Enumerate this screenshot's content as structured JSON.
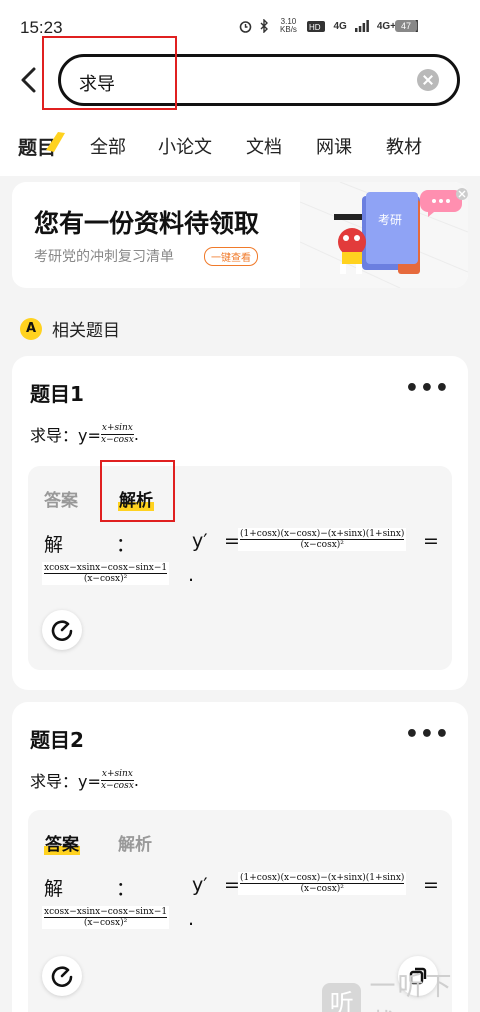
{
  "status_bar": {
    "time": "15:23",
    "speed": "3.10 KB/s",
    "network1": "4G",
    "network2": "4G+",
    "battery": "47"
  },
  "search": {
    "value": "求导"
  },
  "tabs": [
    "题目",
    "全部",
    "小论文",
    "文档",
    "网课",
    "教材"
  ],
  "banner": {
    "title": "您有一份资料待领取",
    "subtitle": "考研党的冲刺复习清单",
    "button": "一键查看",
    "book_label": "考研"
  },
  "section": {
    "badge": "A",
    "label": "相关题目"
  },
  "questions": [
    {
      "title": "题目1",
      "more": "•••",
      "prompt": "求导：y=",
      "frac_num": "x+sinx",
      "frac_den": "x−cosx",
      "tail": ".",
      "tab_answer": "答案",
      "tab_analysis": "解析",
      "sol_word": "解",
      "sol_colon": "：",
      "sol_y": "y′",
      "sol_eq": "=",
      "f1_num": "(1+cosx)(x−cosx)−(x+sinx)(1+sinx)",
      "f1_den": "(x−cosx)²",
      "f2_num": "xcosx−xsinx−cosx−sinx−1",
      "f2_den": "(x−cosx)²",
      "sol_eq2": "=",
      "sol_dot": "."
    },
    {
      "title": "题目2",
      "more": "•••",
      "prompt": "求导：y=",
      "frac_num": "x+sinx",
      "frac_den": "x−cosx",
      "tail": ".",
      "tab_answer": "答案",
      "tab_analysis": "解析",
      "sol_word": "解",
      "sol_colon": "：",
      "sol_y": "y′",
      "sol_eq": "=",
      "f1_num": "(1+cosx)(x−cosx)−(x+sinx)(1+sinx)",
      "f1_den": "(x−cosx)²",
      "f2_num": "xcosx−xsinx−cosx−sinx−1",
      "f2_den": "(x−cosx)²",
      "sol_eq2": "=",
      "sol_dot": "."
    }
  ],
  "watermark": {
    "icon": "听",
    "text": "一听下载"
  },
  "colors": {
    "accent_yellow": "#ffd21f",
    "highlight_red": "#e02020",
    "banner_orange": "#f07a2a"
  }
}
